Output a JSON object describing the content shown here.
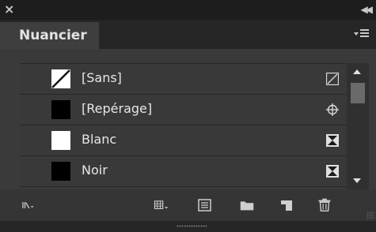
{
  "window": {
    "close_icon": "close-x-icon",
    "collapse_icon": "double-chevron-left-icon",
    "collapse_glyph": "◀◀"
  },
  "tab": {
    "title": "Nuancier",
    "menu_icon": "panel-menu-icon"
  },
  "swatches": [
    {
      "name": "[Sans]",
      "swatch": "none",
      "icon": "no-edit-icon"
    },
    {
      "name": "[Repérage]",
      "swatch": "registration",
      "icon": "registration-icon"
    },
    {
      "name": "Blanc",
      "swatch": "white",
      "icon": "process-color-icon"
    },
    {
      "name": "Noir",
      "swatch": "black",
      "icon": "process-color-icon"
    }
  ],
  "colors": {
    "panel_bg": "#3a3a3a",
    "titlebar_bg": "#1d1d1d",
    "text": "#e6e6e6"
  },
  "footer": {
    "buttons": [
      "swatch-view-icon",
      "new-color-group-icon",
      "show-swatch-kinds-icon",
      "swatch-options-icon",
      "new-folder-icon",
      "new-swatch-icon",
      "delete-icon"
    ]
  }
}
